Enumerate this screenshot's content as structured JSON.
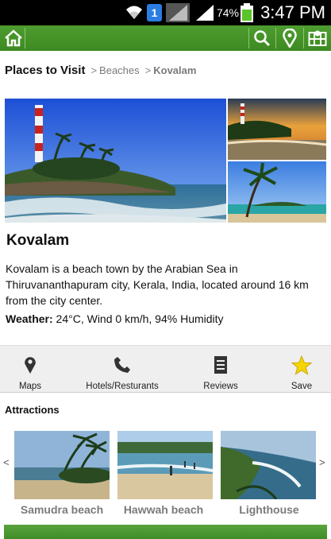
{
  "status_bar": {
    "battery_percent": "74%",
    "time": "3:47 PM",
    "notification_count": "1",
    "icons": [
      "wifi-icon",
      "notification-badge-icon",
      "signal-strength-icon",
      "battery-charging-icon"
    ]
  },
  "app_bar": {
    "color": "#3d8a22",
    "icons": [
      "home-icon",
      "search-icon",
      "map-pin-icon",
      "map-grid-icon"
    ]
  },
  "breadcrumb": {
    "title": "Places to Visit",
    "separator": ">",
    "items": [
      "Beaches",
      "Kovalam"
    ]
  },
  "place": {
    "name": "Kovalam",
    "description": "Kovalam is a beach town by the Arabian Sea in Thiruvananthapuram city, Kerala, India, located around 16 km from the city center.",
    "weather_label": "Weather:",
    "weather_value": "24°C, Wind 0 km/h, 94% Humidity"
  },
  "actions": [
    {
      "label": "Maps",
      "icon": "map-pin-icon"
    },
    {
      "label": "Hotels/Resturants",
      "icon": "phone-icon"
    },
    {
      "label": "Reviews",
      "icon": "document-icon"
    },
    {
      "label": "Save",
      "icon": "star-icon"
    }
  ],
  "attractions": {
    "heading": "Attractions",
    "prev_arrow": "<",
    "next_arrow": ">",
    "items": [
      {
        "label": "Samudra beach"
      },
      {
        "label": "Hawwah beach"
      },
      {
        "label": "Lighthouse"
      }
    ]
  },
  "colors": {
    "accent_green": "#3d8a22",
    "star_yellow": "#f5d400"
  }
}
